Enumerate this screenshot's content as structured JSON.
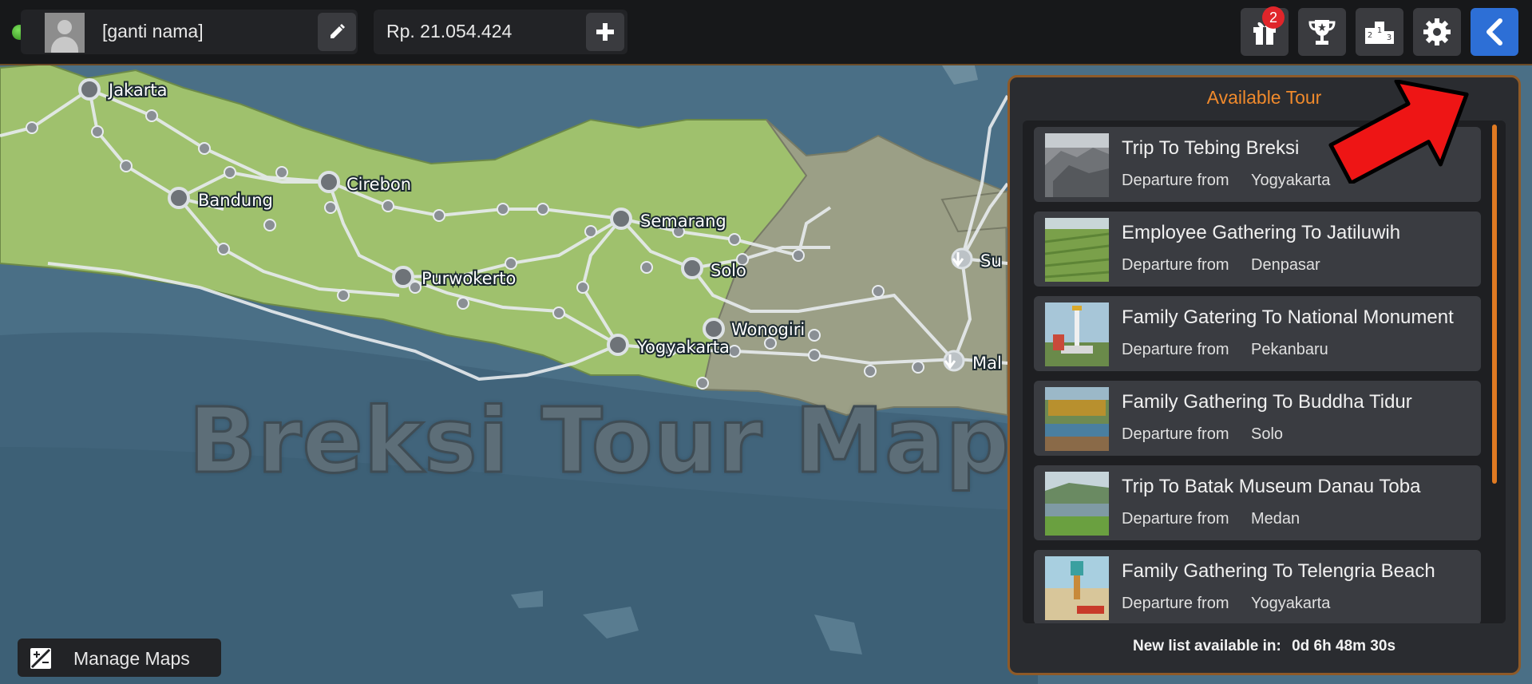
{
  "hud": {
    "player_name": "[ganti nama]",
    "money": "Rp. 21.054.424",
    "gift_badge_count": "2",
    "icons": [
      "edit-icon",
      "add-icon",
      "gift-icon",
      "trophy-icon",
      "leaderboard-icon",
      "gear-icon",
      "back-arrow-icon"
    ],
    "status_color": "#3fb02a",
    "back_button_color": "#2d6fd6"
  },
  "map": {
    "watermark": "Breksi Tour Map",
    "cities": [
      "Jakarta",
      "Bandung",
      "Cirebon",
      "Semarang",
      "Purwokerto",
      "Solo",
      "Wonogiri",
      "Yogyakarta",
      "Su",
      "Mal"
    ],
    "colors": {
      "sea": "#4a6f86",
      "active_land": "#9fc16d",
      "inactive_land": "#9b9f86"
    }
  },
  "panel": {
    "title": "Available Tour",
    "departure_label": "Departure from",
    "tours": [
      {
        "title": "Trip To Tebing Breksi",
        "departure": "Yogyakarta"
      },
      {
        "title": "Employee Gathering To Jatiluwih",
        "departure": "Denpasar"
      },
      {
        "title": "Family Gatering To National Monument",
        "departure": "Pekanbaru"
      },
      {
        "title": "Family Gathering To Buddha Tidur",
        "departure": "Solo"
      },
      {
        "title": "Trip To Batak Museum Danau Toba",
        "departure": "Medan"
      },
      {
        "title": "Family Gathering To Telengria Beach",
        "departure": "Yogyakarta"
      }
    ],
    "refresh_label": "New list available in:",
    "refresh_time": "0d 6h 48m 30s",
    "accent_color": "#f08a2c"
  },
  "footer": {
    "manage_maps": "Manage Maps"
  }
}
